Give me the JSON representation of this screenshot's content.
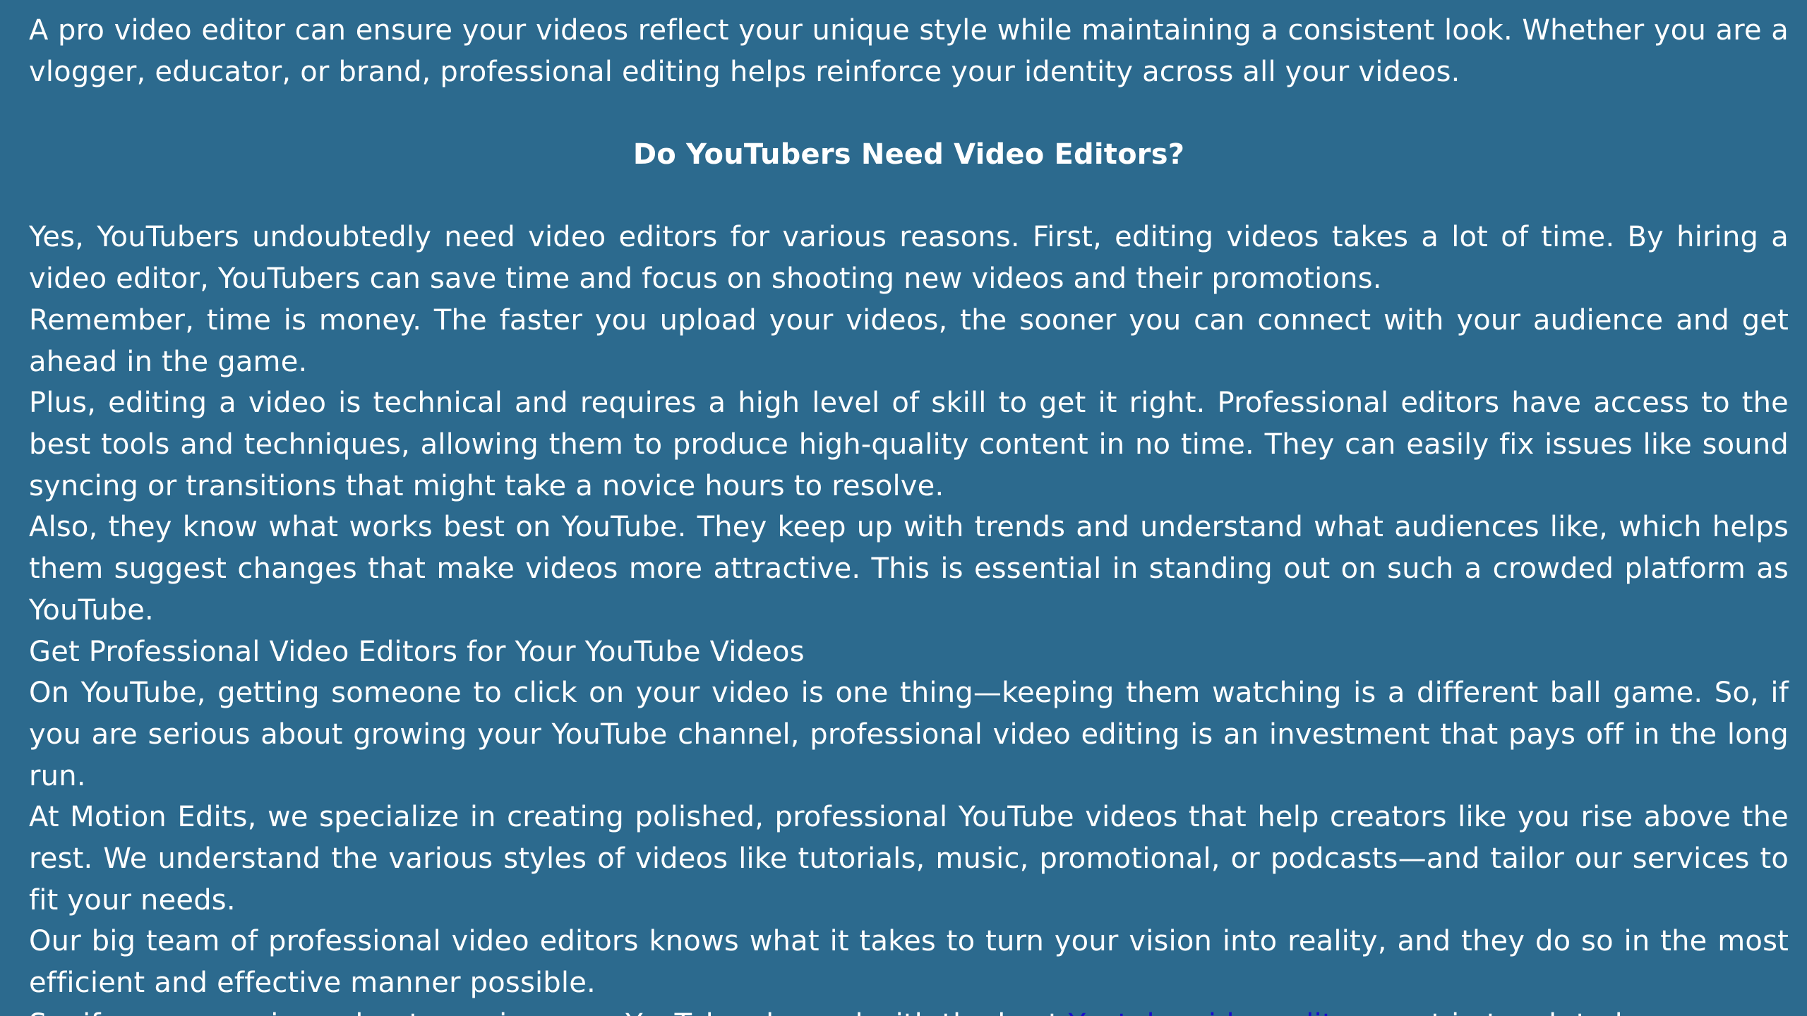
{
  "content": {
    "intro": "A pro video editor can ensure your videos reflect your unique style while maintaining a consistent look. Whether you are a vlogger, educator, or brand, professional editing helps reinforce your identity across all your videos.",
    "heading": "Do YouTubers Need Video Editors?",
    "p1": "Yes, YouTubers undoubtedly need video editors for various reasons. First, editing videos takes a lot of time. By hiring a video editor, YouTubers can save time and focus on shooting new videos and their promotions.",
    "p2": "Remember, time is money. The faster you upload your videos, the sooner you can connect with your audience and get ahead in the game.",
    "p3": "Plus, editing a video is technical and requires a high level of skill to get it right. Professional editors have access to the best tools and techniques, allowing them to produce high-quality content in no time. They can easily fix issues like sound syncing or transitions that might take a novice hours to resolve.",
    "p4": "Also, they know what works best on YouTube. They keep up with trends and understand what audiences like, which helps them suggest changes that make videos more attractive. This is essential in standing out on such a crowded platform as YouTube.",
    "subheading": "Get Professional Video Editors for Your YouTube Videos",
    "p5": "On YouTube, getting someone to click on your video is one thing—keeping them watching is a different ball game. So, if you are serious about growing your YouTube channel, professional video editing is an investment that pays off in the long run.",
    "p6": "At Motion Edits, we specialize in creating polished, professional YouTube videos that help creators like you rise above the rest. We understand the various styles of videos like tutorials, music, promotional, or podcasts—and tailor our services to fit your needs.",
    "p7": "Our big team of professional video editors knows what it takes to turn your vision into reality, and they do so in the most efficient and effective manner possible.",
    "closing_before": "So, if you are serious about growing your YouTube channel with the best ",
    "closing_link": "Youtube video editors",
    "closing_after": ", get in touch today."
  },
  "colors": {
    "background": "#2C6A8E",
    "text": "#FFFFFF",
    "link": "#1A0DCC"
  }
}
